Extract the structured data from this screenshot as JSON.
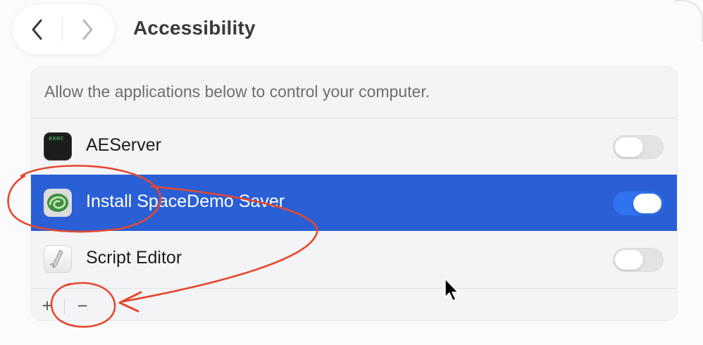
{
  "window": {
    "title": "Accessibility"
  },
  "nav": {
    "back_icon": "chevron-left-icon",
    "forward_icon": "chevron-right-icon"
  },
  "panel": {
    "description": "Allow the applications below to control your computer.",
    "apps": [
      {
        "name": "AEServer",
        "icon": "exec-terminal-icon",
        "icon_text": "exec",
        "enabled": false,
        "selected": false
      },
      {
        "name": "Install SpaceDemo Saver",
        "icon": "green-swirl-icon",
        "enabled": true,
        "selected": true
      },
      {
        "name": "Script Editor",
        "icon": "script-editor-icon",
        "enabled": false,
        "selected": false
      }
    ],
    "footer": {
      "add_label": "+",
      "remove_label": "−"
    }
  },
  "colors": {
    "selection": "#2a5fd6",
    "toggle_on": "#2f73f0",
    "annotation": "#e5482c"
  }
}
